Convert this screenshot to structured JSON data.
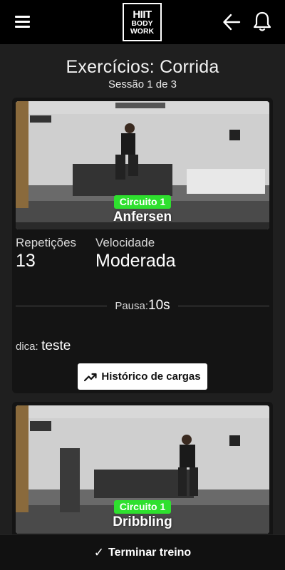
{
  "header": {
    "logo": {
      "line1": "HIIT",
      "line2": "BODY",
      "line3": "WORK"
    },
    "menu_icon": "menu-icon",
    "back_icon": "arrow-left-icon",
    "notification_icon": "bell-icon"
  },
  "page": {
    "title": "Exercícios: Corrida",
    "subtitle": "Sessão 1 de 3"
  },
  "exercises": [
    {
      "circuit": "Circuito 1",
      "name": "Anfersen",
      "reps_label": "Repetições",
      "reps_value": "13",
      "speed_label": "Velocidade",
      "speed_value": "Moderada",
      "pause_label": "Pausa:",
      "pause_value": "10s",
      "tip_label": "dica:",
      "tip_value": "teste",
      "history_button": "Histórico de cargas"
    },
    {
      "circuit": "Circuito 1",
      "name": "Dribbling"
    }
  ],
  "footer": {
    "check": "✓",
    "finish_label": "Terminar treino"
  },
  "colors": {
    "header_bg": "#000000",
    "background": "#1f1f1f",
    "card_bg": "#141414",
    "circuit_badge": "#2ee02e",
    "button_bg": "#ffffff"
  }
}
